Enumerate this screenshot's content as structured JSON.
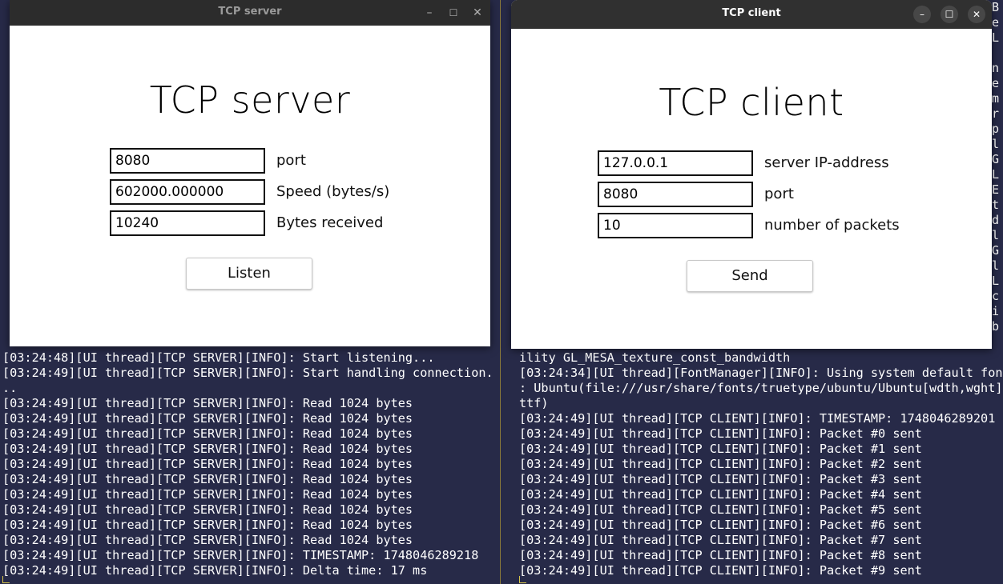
{
  "terminal_left": {
    "lines": [
      "[03:24:48][UI thread][TCP SERVER][INFO]: Start listening...",
      "[03:24:49][UI thread][TCP SERVER][INFO]: Start handling connection.",
      "..",
      "[03:24:49][UI thread][TCP SERVER][INFO]: Read 1024 bytes",
      "[03:24:49][UI thread][TCP SERVER][INFO]: Read 1024 bytes",
      "[03:24:49][UI thread][TCP SERVER][INFO]: Read 1024 bytes",
      "[03:24:49][UI thread][TCP SERVER][INFO]: Read 1024 bytes",
      "[03:24:49][UI thread][TCP SERVER][INFO]: Read 1024 bytes",
      "[03:24:49][UI thread][TCP SERVER][INFO]: Read 1024 bytes",
      "[03:24:49][UI thread][TCP SERVER][INFO]: Read 1024 bytes",
      "[03:24:49][UI thread][TCP SERVER][INFO]: Read 1024 bytes",
      "[03:24:49][UI thread][TCP SERVER][INFO]: Read 1024 bytes",
      "[03:24:49][UI thread][TCP SERVER][INFO]: Read 1024 bytes",
      "[03:24:49][UI thread][TCP SERVER][INFO]: TIMESTAMP: 1748046289218",
      "[03:24:49][UI thread][TCP SERVER][INFO]: Delta time: 17 ms"
    ],
    "edge_chars": [
      "G",
      "E",
      "d",
      "b",
      "e",
      "",
      "s",
      "a",
      "L",
      "m",
      "S",
      "u",
      "",
      "e",
      "L",
      "o",
      "",
      "o",
      "n",
      "i",
      "[",
      ":",
      "t"
    ]
  },
  "terminal_right": {
    "lines": [
      "ility GL_MESA_texture_const_bandwidth",
      "[03:24:34][UI thread][FontManager][INFO]: Using system default font",
      ": Ubuntu(file:///usr/share/fonts/truetype/ubuntu/Ubuntu[wdth,wght].",
      "ttf)",
      "[03:24:49][UI thread][TCP CLIENT][INFO]: TIMESTAMP: 1748046289201",
      "[03:24:49][UI thread][TCP CLIENT][INFO]: Packet #0 sent",
      "[03:24:49][UI thread][TCP CLIENT][INFO]: Packet #1 sent",
      "[03:24:49][UI thread][TCP CLIENT][INFO]: Packet #2 sent",
      "[03:24:49][UI thread][TCP CLIENT][INFO]: Packet #3 sent",
      "[03:24:49][UI thread][TCP CLIENT][INFO]: Packet #4 sent",
      "[03:24:49][UI thread][TCP CLIENT][INFO]: Packet #5 sent",
      "[03:24:49][UI thread][TCP CLIENT][INFO]: Packet #6 sent",
      "[03:24:49][UI thread][TCP CLIENT][INFO]: Packet #7 sent",
      "[03:24:49][UI thread][TCP CLIENT][INFO]: Packet #8 sent",
      "[03:24:49][UI thread][TCP CLIENT][INFO]: Packet #9 sent"
    ],
    "edge_chars": [
      "B",
      "e",
      "L",
      "",
      "n",
      "e",
      "m",
      "r",
      "p",
      "l",
      "G",
      "L",
      "E",
      "t",
      "d",
      "l",
      "G",
      "l",
      "L",
      "c",
      "i",
      "b"
    ]
  },
  "server_window": {
    "title": "TCP server",
    "heading": "TCP server",
    "port_value": "8080",
    "port_label": "port",
    "speed_value": "602000.000000",
    "speed_label": "Speed (bytes/s)",
    "bytes_value": "10240",
    "bytes_label": "Bytes received",
    "button_label": "Listen",
    "controls": {
      "minimize": "–",
      "maximize": "☐",
      "close": "✕"
    }
  },
  "client_window": {
    "title": "TCP client",
    "heading": "TCP client",
    "ip_value": "127.0.0.1",
    "ip_label": "server IP-address",
    "port_value": "8080",
    "port_label": "port",
    "packets_value": "10",
    "packets_label": "number of packets",
    "button_label": "Send",
    "controls": {
      "minimize": "–",
      "maximize": "☐",
      "close": "✕"
    }
  }
}
